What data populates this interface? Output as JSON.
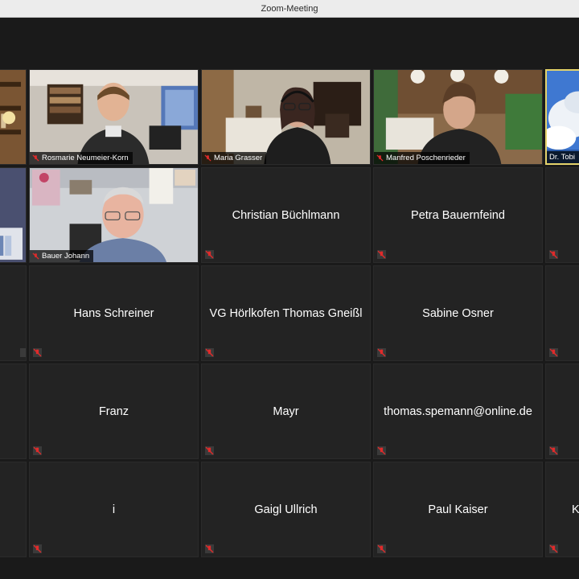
{
  "window": {
    "title": "Zoom-Meeting"
  },
  "participants": [
    {
      "name": "",
      "video": true
    },
    {
      "name": "Rosmarie Neumeier-Korn",
      "video": true
    },
    {
      "name": "Maria Grasser",
      "video": true
    },
    {
      "name": "Manfred Poschenrieder",
      "video": true
    },
    {
      "name": "Dr. Tobi",
      "video": true
    },
    {
      "name": "",
      "video": true
    },
    {
      "name": "Bauer Johann",
      "video": true
    },
    {
      "name": "Christian Büchlmann",
      "video": false
    },
    {
      "name": "Petra Bauernfeind",
      "video": false
    },
    {
      "name": "",
      "video": false
    },
    {
      "name": "",
      "video": false
    },
    {
      "name": "Hans Schreiner",
      "video": false
    },
    {
      "name": "VG Hörlkofen Thomas Gneißl",
      "video": false
    },
    {
      "name": "Sabine Osner",
      "video": false
    },
    {
      "name": "",
      "video": false
    },
    {
      "name": "",
      "video": false
    },
    {
      "name": "Franz",
      "video": false
    },
    {
      "name": "Mayr",
      "video": false
    },
    {
      "name": "thomas.spemann@online.de",
      "video": false
    },
    {
      "name": "",
      "video": false
    },
    {
      "name": "",
      "video": false
    },
    {
      "name": "i",
      "video": false
    },
    {
      "name": "Gaigl Ullrich",
      "video": false
    },
    {
      "name": "Paul Kaiser",
      "video": false
    },
    {
      "name": "K",
      "video": false
    }
  ],
  "icons": {
    "muted": "muted-mic-icon"
  },
  "colors": {
    "active_speaker": "#e4d36b",
    "mute_red": "#e02b2b"
  }
}
